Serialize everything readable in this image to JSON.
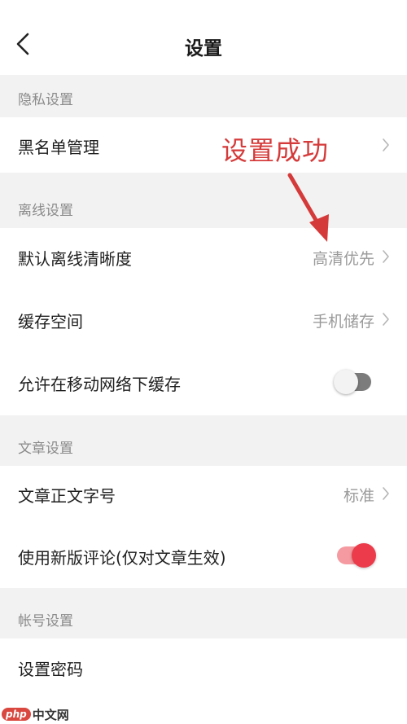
{
  "header": {
    "title": "设置",
    "back_icon": "chevron-left-icon"
  },
  "sections": {
    "privacy": {
      "title": "隐私设置",
      "blacklist_label": "黑名单管理"
    },
    "offline": {
      "title": "离线设置",
      "default_quality_label": "默认离线清晰度",
      "default_quality_value": "高清优先",
      "cache_space_label": "缓存空间",
      "cache_space_value": "手机储存",
      "mobile_cache_label": "允许在移动网络下缓存",
      "mobile_cache_enabled": false
    },
    "article": {
      "title": "文章设置",
      "font_size_label": "文章正文字号",
      "font_size_value": "标准",
      "new_comments_label": "使用新版评论(仅对文章生效)",
      "new_comments_enabled": true
    },
    "account": {
      "title": "帐号设置",
      "password_label": "设置密码"
    }
  },
  "annotation": {
    "text": "设置成功",
    "color": "#d53a3a"
  },
  "watermark": {
    "logo": "php",
    "text": "中文网"
  },
  "colors": {
    "accent": "#ec3b4a",
    "section_bg": "#f2f2f2",
    "secondary_text": "#9a9a9a"
  }
}
